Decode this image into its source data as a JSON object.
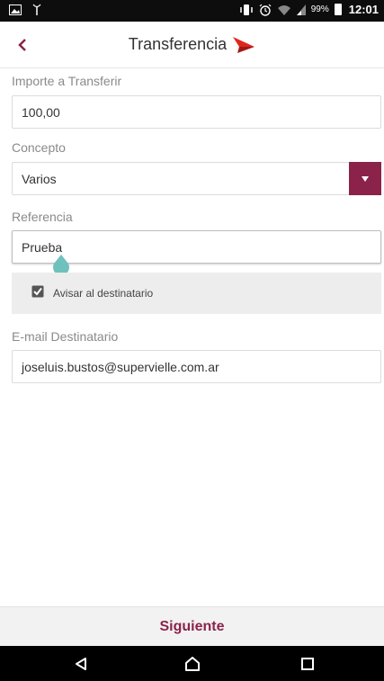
{
  "status_bar": {
    "battery": "99%",
    "time": "12:01"
  },
  "header": {
    "title": "Transferencia"
  },
  "form": {
    "amount": {
      "label": "Importe a Transferir",
      "value": "100,00"
    },
    "concept": {
      "label": "Concepto",
      "value": "Varios"
    },
    "reference": {
      "label": "Referencia",
      "value": "Prueba"
    },
    "notify": {
      "label": "Avisar al destinatario",
      "checked": true
    },
    "email": {
      "label": "E-mail Destinatario",
      "value": "joseluis.bustos@supervielle.com.ar"
    }
  },
  "actions": {
    "next_label": "Siguiente"
  },
  "colors": {
    "brand": "#8b2249",
    "logo_red": "#e1261c",
    "cursor_handle": "#6fc1bd"
  }
}
